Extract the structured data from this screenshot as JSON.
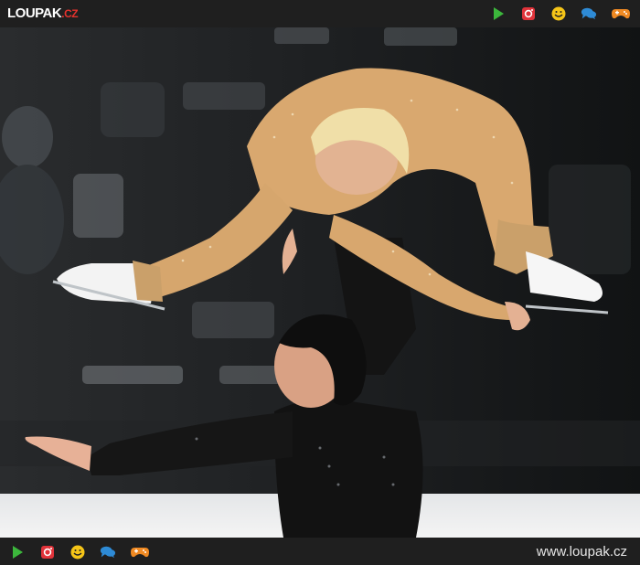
{
  "header": {
    "logo_main": "LOUPAK",
    "logo_suffix": ".CZ",
    "icons": [
      "play-icon",
      "instagram-icon",
      "smiley-icon",
      "chat-icon",
      "gamepad-icon"
    ]
  },
  "photo": {
    "subject": "pair-figure-skating-lift"
  },
  "footer": {
    "url": "www.loupak.cz",
    "icons": [
      "play-icon",
      "instagram-icon",
      "smiley-icon",
      "chat-icon",
      "gamepad-icon"
    ]
  },
  "colors": {
    "play": "#3cb73c",
    "instagram": "#e0333a",
    "smiley": "#f5c518",
    "chat": "#2e8bd6",
    "gamepad": "#f08a23",
    "brand": "#e5322d"
  }
}
